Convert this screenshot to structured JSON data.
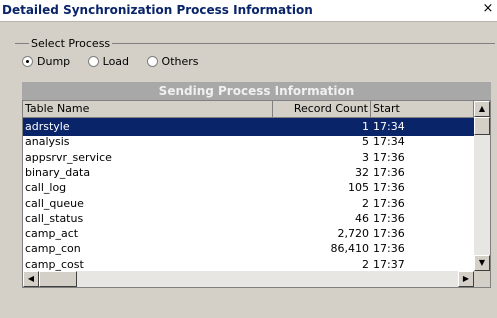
{
  "window": {
    "title": "Detailed Synchronization Process Information",
    "close_glyph": "×"
  },
  "select_process": {
    "label": "Select Process",
    "options": [
      {
        "label": "Dump",
        "checked": true
      },
      {
        "label": "Load",
        "checked": false
      },
      {
        "label": "Others",
        "checked": false
      }
    ]
  },
  "section_title": "Sending Process Information",
  "table": {
    "columns": [
      "Table Name",
      "Record Count",
      "Start"
    ],
    "rows": [
      {
        "name": "adrstyle",
        "count": "1",
        "start": "17:34",
        "selected": true
      },
      {
        "name": "analysis",
        "count": "5",
        "start": "17:34"
      },
      {
        "name": "appsrvr_service",
        "count": "3",
        "start": "17:36"
      },
      {
        "name": "binary_data",
        "count": "32",
        "start": "17:36"
      },
      {
        "name": "call_log",
        "count": "105",
        "start": "17:36"
      },
      {
        "name": "call_queue",
        "count": "2",
        "start": "17:36"
      },
      {
        "name": "call_status",
        "count": "46",
        "start": "17:36"
      },
      {
        "name": "camp_act",
        "count": "2,720",
        "start": "17:36"
      },
      {
        "name": "camp_con",
        "count": "86,410",
        "start": "17:36"
      },
      {
        "name": "camp_cost",
        "count": "2",
        "start": "17:37"
      }
    ]
  },
  "colors": {
    "title_text": "#0a246a",
    "selection": "#0a246a",
    "banner": "#a8a8a8"
  }
}
